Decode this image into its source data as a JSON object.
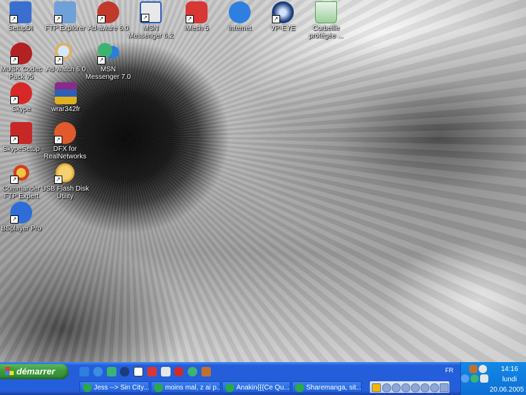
{
  "desktop": {
    "icons": [
      {
        "label": "SetupDI",
        "icon": "setup-icon",
        "color": "#3a6fd0"
      },
      {
        "label": "FTP Explorer",
        "icon": "ftp-explorer-icon",
        "color": "#6fa0d8"
      },
      {
        "label": "Ad-aware 6.0",
        "icon": "adaware-icon",
        "color": "#c0392b"
      },
      {
        "label": "MSN Messenger 6.2",
        "icon": "window-icon",
        "color": "#2a5bb8"
      },
      {
        "label": "iMesh 5",
        "icon": "imesh-icon",
        "color": "#d93636"
      },
      {
        "label": "Internet",
        "icon": "internet-explorer-icon",
        "color": "#2f7fe0"
      },
      {
        "label": "VP-EYE",
        "icon": "vp-eye-icon",
        "color": "#1d3d7a"
      },
      {
        "label": "Corbeille protégée ...",
        "icon": "recycle-bin-icon",
        "color": "#4aa84a"
      },
      {
        "label": "MUSK Codec Pack v5",
        "icon": "codec-icon",
        "color": "#b22222"
      },
      {
        "label": "Ad-watch 6.0",
        "icon": "magnifier-icon",
        "color": "#e0b060"
      },
      {
        "label": "MSN Messenger 7.0",
        "icon": "msn-people-icon",
        "color": "#3cb371"
      },
      {
        "label": "Skype",
        "icon": "skype-icon",
        "color": "#d62828"
      },
      {
        "label": "wrar342fr",
        "icon": "winrar-icon",
        "color": "#8a2b8a"
      },
      {
        "label": "SkypeSetup",
        "icon": "skype-setup-icon",
        "color": "#c62828"
      },
      {
        "label": "DFX for RealNetworks",
        "icon": "dfx-icon",
        "color": "#e05a2b"
      },
      {
        "label": "Commander FTP Expert",
        "icon": "commander-ftp-icon",
        "color": "#d04020"
      },
      {
        "label": "USB Flash Disk Utility",
        "icon": "usb-icon",
        "color": "#e0a030"
      },
      {
        "label": "BSplayer Pro",
        "icon": "bsplayer-icon",
        "color": "#2d6ed6"
      }
    ]
  },
  "taskbar": {
    "start_label": "démarrer",
    "language": "FR",
    "buttons": [
      {
        "label": "Jess --> Sin City..."
      },
      {
        "label": "moins mal, z ai p..."
      },
      {
        "label": "Anakin{{{Ce Qu..."
      },
      {
        "label": "Sharemanga, sit..."
      }
    ],
    "clock": {
      "time": "14:16",
      "day": "lundi",
      "date": "20.06.2005"
    }
  },
  "colors": {
    "taskbar_blue": "#245edb",
    "start_green": "#3c9a3c",
    "tray_blue": "#0e6fd6"
  }
}
